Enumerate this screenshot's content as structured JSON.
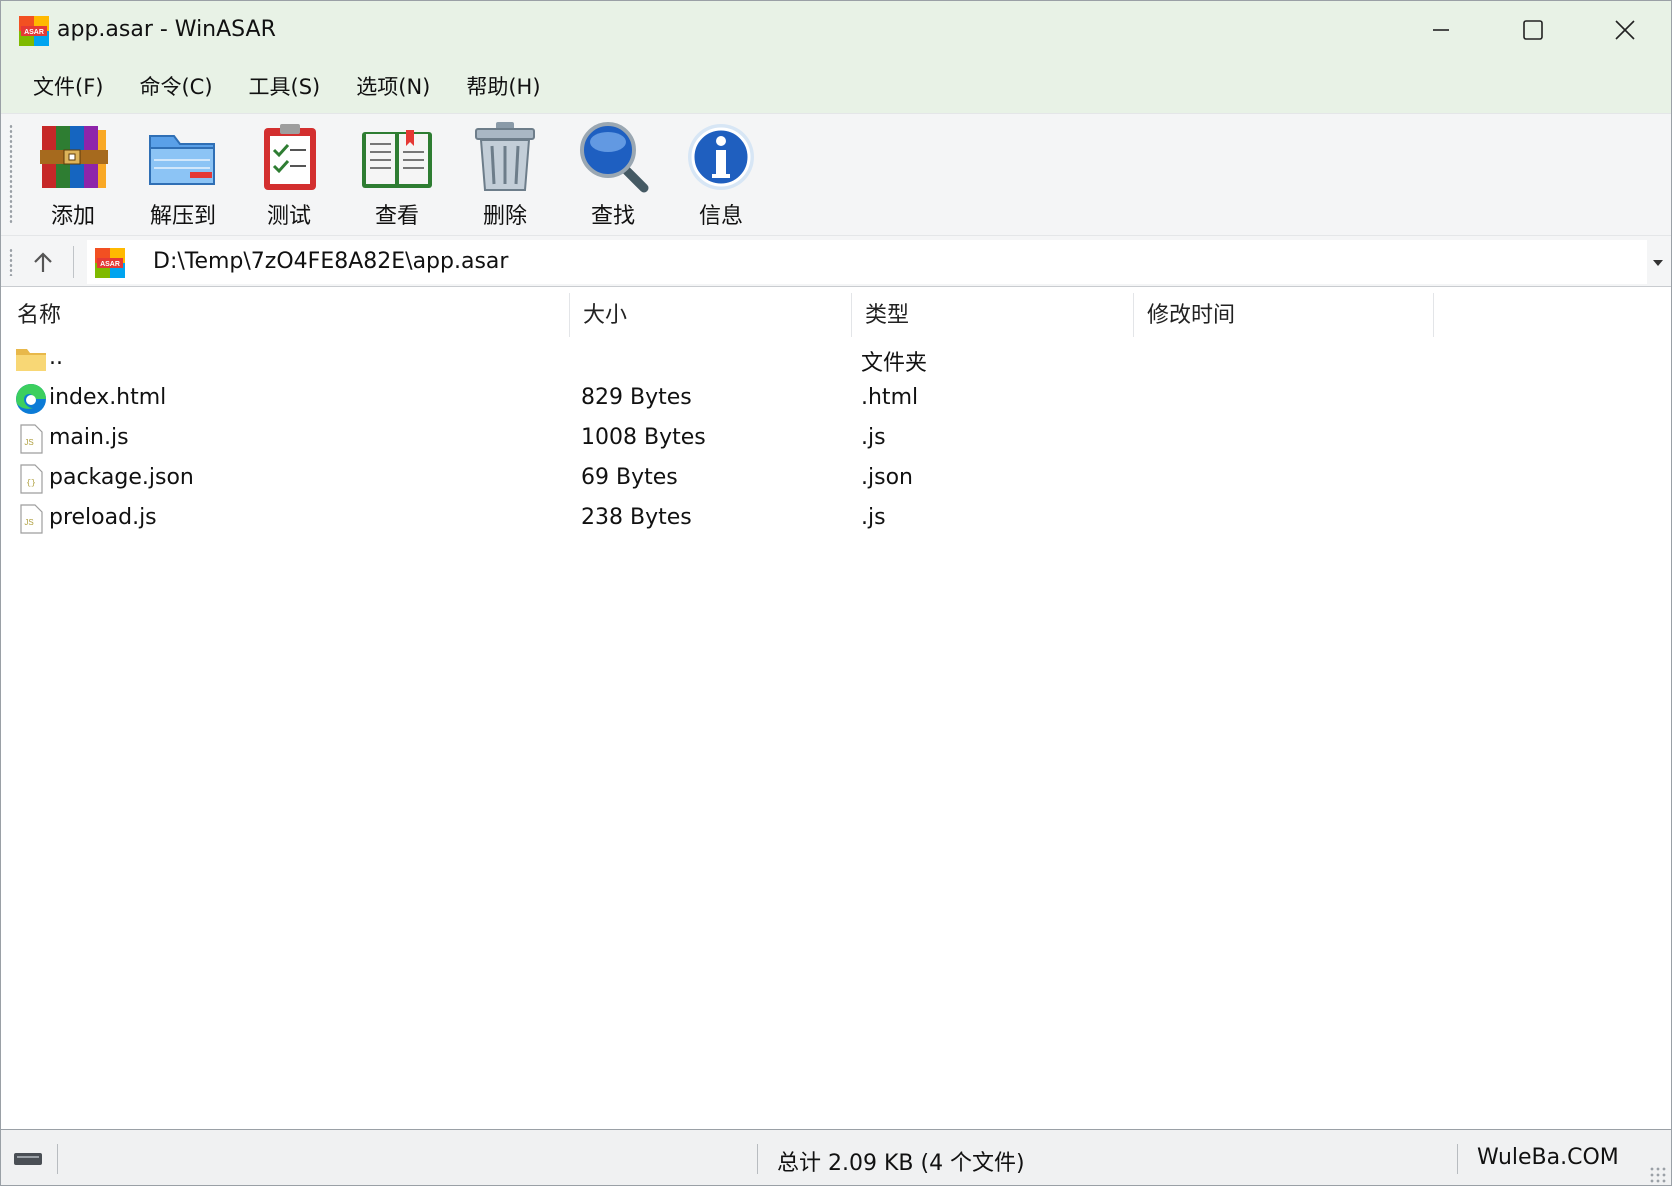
{
  "window": {
    "title": "app.asar - WinASAR",
    "app_icon": "asar-icon",
    "controls": [
      "minimize",
      "maximize",
      "close"
    ]
  },
  "menu": [
    {
      "label": "文件(F)"
    },
    {
      "label": "命令(C)"
    },
    {
      "label": "工具(S)"
    },
    {
      "label": "选项(N)"
    },
    {
      "label": "帮助(H)"
    }
  ],
  "toolbar": [
    {
      "label": "添加",
      "icon": "archive-books-icon"
    },
    {
      "label": "解压到",
      "icon": "folder-extract-icon"
    },
    {
      "label": "测试",
      "icon": "clipboard-check-icon"
    },
    {
      "label": "查看",
      "icon": "open-book-icon"
    },
    {
      "label": "删除",
      "icon": "trash-can-icon"
    },
    {
      "label": "查找",
      "icon": "magnifier-icon"
    },
    {
      "label": "信息",
      "icon": "info-icon"
    }
  ],
  "address": {
    "path": "D:\\Temp\\7zO4FE8A82E\\app.asar",
    "icon": "asar-icon"
  },
  "columns": [
    "名称",
    "大小",
    "类型",
    "修改时间"
  ],
  "files": [
    {
      "name": "..",
      "size": "",
      "type": "文件夹",
      "modified": "",
      "icon": "folder-icon"
    },
    {
      "name": "index.html",
      "size": "829 Bytes",
      "type": ".html",
      "modified": "",
      "icon": "edge-icon"
    },
    {
      "name": "main.js",
      "size": "1008 Bytes",
      "type": ".js",
      "modified": "",
      "icon": "js-file-icon"
    },
    {
      "name": "package.json",
      "size": "69 Bytes",
      "type": ".json",
      "modified": "",
      "icon": "json-file-icon"
    },
    {
      "name": "preload.js",
      "size": "238 Bytes",
      "type": ".js",
      "modified": "",
      "icon": "js-file-icon"
    }
  ],
  "status": {
    "summary": "总计 2.09 KB (4 个文件)",
    "brand": "WuleBa.COM"
  }
}
